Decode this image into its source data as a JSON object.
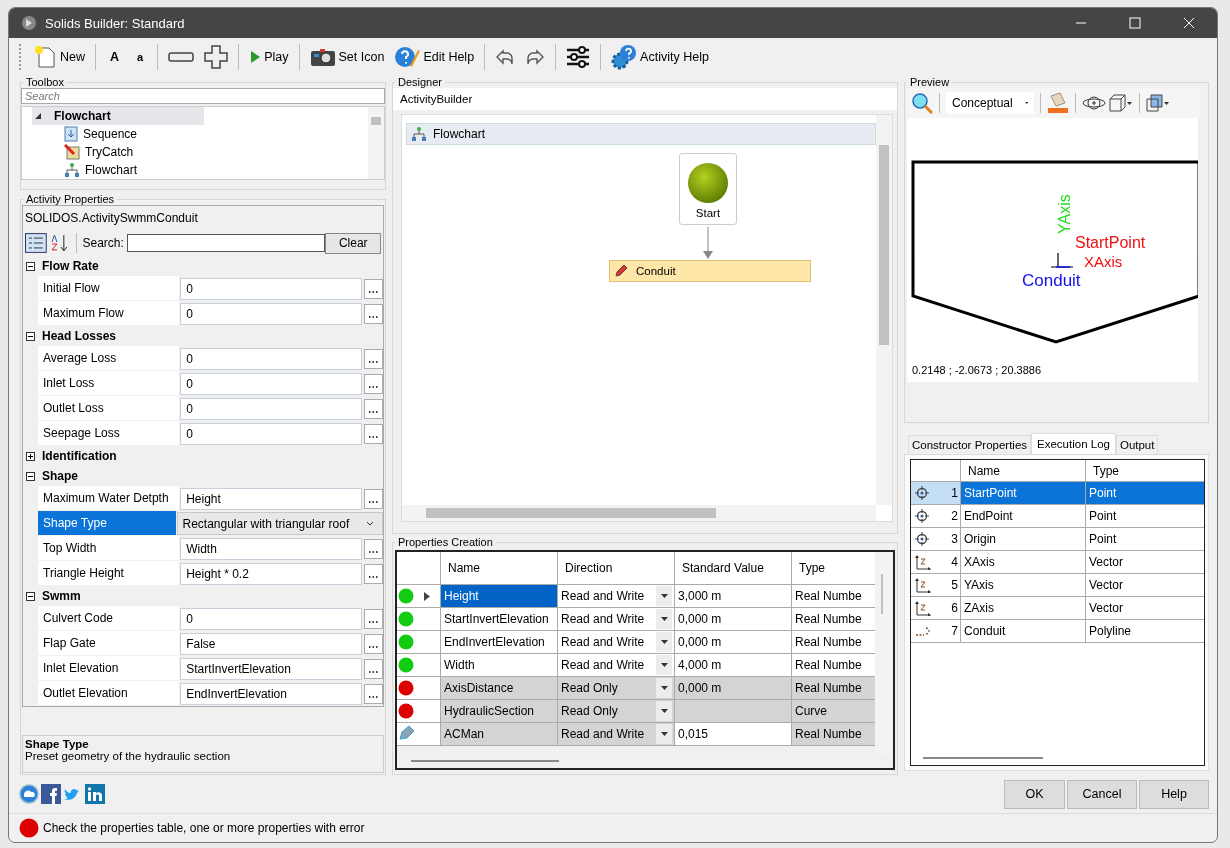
{
  "window": {
    "title": "Solids Builder: Standard"
  },
  "toolbar": [
    [
      {
        "kind": "new",
        "label": "New"
      }
    ],
    [
      {
        "kind": "font-large",
        "label": "A"
      },
      {
        "kind": "font-small",
        "label": "a"
      }
    ],
    [
      {
        "kind": "minus"
      },
      {
        "kind": "plus"
      }
    ],
    [
      {
        "kind": "play",
        "label": "Play"
      }
    ],
    [
      {
        "kind": "camera",
        "label": "Set Icon"
      },
      {
        "kind": "edit-help",
        "label": "Edit Help"
      }
    ],
    [
      {
        "kind": "undo"
      },
      {
        "kind": "redo"
      }
    ],
    [
      {
        "kind": "sliders"
      }
    ],
    [
      {
        "kind": "gear-help",
        "label": "Activity Help"
      }
    ]
  ],
  "toolbox": {
    "title": "Toolbox",
    "placeholder": "Search",
    "tree": [
      {
        "label": "Flowchart",
        "expanded": true,
        "selected": true,
        "children": [
          {
            "label": "Sequence",
            "kind": "sequence"
          },
          {
            "label": "TryCatch",
            "kind": "trycatch"
          },
          {
            "label": "Flowchart",
            "kind": "flowchart"
          }
        ]
      }
    ]
  },
  "activity_properties": {
    "title": "Activity Properties",
    "object": "SOLIDOS.ActivitySwmmConduit",
    "search_label": "Search:",
    "clear": "Clear",
    "categories": [
      {
        "name": "Flow Rate",
        "expanded": true,
        "properties": [
          {
            "name": "Initial Flow",
            "value": "0",
            "kind": "text",
            "selected": false
          },
          {
            "name": "Maximum Flow",
            "value": "0",
            "kind": "text",
            "selected": false
          }
        ]
      },
      {
        "name": "Head Losses",
        "expanded": true,
        "properties": [
          {
            "name": "Average Loss",
            "value": "0",
            "kind": "text",
            "selected": false
          },
          {
            "name": "Inlet Loss",
            "value": "0",
            "kind": "text",
            "selected": false
          },
          {
            "name": "Outlet Loss",
            "value": "0",
            "kind": "text",
            "selected": false
          },
          {
            "name": "Seepage Loss",
            "value": "0",
            "kind": "text",
            "selected": false
          }
        ]
      },
      {
        "name": "Identification",
        "expanded": false
      },
      {
        "name": "Shape",
        "expanded": true,
        "properties": [
          {
            "name": "Maximum Water Detpth",
            "value": "Height",
            "kind": "text",
            "selected": false
          },
          {
            "name": "Shape Type",
            "value": "Rectangular with triangular roof",
            "kind": "dropdown",
            "selected": true
          },
          {
            "name": "Top Width",
            "value": "Width",
            "kind": "text",
            "selected": false
          },
          {
            "name": "Triangle Height",
            "value": "Height * 0.2",
            "kind": "text",
            "selected": false
          }
        ]
      },
      {
        "name": "Swmm",
        "expanded": true,
        "properties": [
          {
            "name": "Culvert Code",
            "value": "0",
            "kind": "text",
            "selected": false
          },
          {
            "name": "Flap Gate",
            "value": "False",
            "kind": "text",
            "selected": false
          },
          {
            "name": "Inlet Elevation",
            "value": "StartInvertElevation",
            "kind": "text",
            "selected": false
          },
          {
            "name": "Outlet Elevation",
            "value": "EndInvertElevation",
            "kind": "text",
            "selected": false
          }
        ]
      }
    ],
    "description": {
      "title": "Shape Type",
      "text": "Preset geometry of the hydraulic section"
    }
  },
  "designer": {
    "title": "Designer",
    "breadcrumb": "ActivityBuilder",
    "flowchart": "Flowchart",
    "start": "Start",
    "activity": "Conduit"
  },
  "properties_creation": {
    "title": "Properties Creation",
    "columns": [
      "Name",
      "Direction",
      "Standard Value",
      "Type"
    ],
    "rows": [
      {
        "status": {
          "kind": "dot",
          "color": "#11cc11"
        },
        "current": true,
        "selected": true,
        "locked": false,
        "read_only": false,
        "name": "Height",
        "direction": "Read and Write",
        "value": "3,000 m",
        "type": "Real Numbe"
      },
      {
        "status": {
          "kind": "dot",
          "color": "#11cc11"
        },
        "current": false,
        "selected": false,
        "locked": false,
        "read_only": false,
        "name": "StartInvertElevation",
        "direction": "Read and Write",
        "value": "0,000 m",
        "type": "Real Numbe"
      },
      {
        "status": {
          "kind": "dot",
          "color": "#11cc11"
        },
        "current": false,
        "selected": false,
        "locked": false,
        "read_only": false,
        "name": "EndInvertElevation",
        "direction": "Read and Write",
        "value": "0,000 m",
        "type": "Real Numbe"
      },
      {
        "status": {
          "kind": "dot",
          "color": "#11cc11"
        },
        "current": false,
        "selected": false,
        "locked": false,
        "read_only": false,
        "name": "Width",
        "direction": "Read and Write",
        "value": "4,000 m",
        "type": "Real Numbe"
      },
      {
        "status": {
          "kind": "dot",
          "color": "#dd0000"
        },
        "current": false,
        "selected": false,
        "locked": true,
        "read_only": true,
        "name": "AxisDistance",
        "direction": "Read Only",
        "value": "0,000 m",
        "type": "Real Numbe"
      },
      {
        "status": {
          "kind": "dot",
          "color": "#dd0000"
        },
        "current": false,
        "selected": false,
        "locked": true,
        "read_only": true,
        "name": "HydraulicSection",
        "direction": "Read Only",
        "type": "Curve"
      },
      {
        "status": {
          "kind": "pencil"
        },
        "current": false,
        "selected": false,
        "locked": true,
        "read_only": false,
        "name": "ACMan",
        "direction": "Read and Write",
        "value": "0,015",
        "type": "Real Numbe"
      }
    ]
  },
  "preview": {
    "title": "Preview",
    "render_mode": "Conceptual",
    "labels": [
      {
        "kind": "y-axis",
        "text": "YAxis",
        "color": "#22dd22"
      },
      {
        "kind": "start",
        "text": "StartPoint",
        "color": "#ee1111"
      },
      {
        "kind": "x-axis",
        "text": "XAxis",
        "color": "#ee1111"
      },
      {
        "kind": "name",
        "text": "Conduit",
        "color": "#1111ee"
      }
    ],
    "coordinates": "0.2148 ; -2.0673 ; 20.3886"
  },
  "tabs": [
    {
      "label": "Constructor Properties",
      "selected": false
    },
    {
      "label": "Execution Log",
      "selected": true
    },
    {
      "label": "Output",
      "selected": false
    }
  ],
  "log": {
    "columns": [
      "Name",
      "Type"
    ],
    "rows": [
      {
        "index": "1",
        "name": "StartPoint",
        "type": "Point",
        "kind": "point",
        "selected": true
      },
      {
        "index": "2",
        "name": "EndPoint",
        "type": "Point",
        "kind": "point",
        "selected": false
      },
      {
        "index": "3",
        "name": "Origin",
        "type": "Point",
        "kind": "point",
        "selected": false
      },
      {
        "index": "4",
        "name": "XAxis",
        "type": "Vector",
        "kind": "vector",
        "selected": false
      },
      {
        "index": "5",
        "name": "YAxis",
        "type": "Vector",
        "kind": "vector",
        "selected": false
      },
      {
        "index": "6",
        "name": "ZAxis",
        "type": "Vector",
        "kind": "vector",
        "selected": false
      },
      {
        "index": "7",
        "name": "Conduit",
        "type": "Polyline",
        "kind": "polyline",
        "selected": false
      }
    ]
  },
  "buttons": [
    "OK",
    "Cancel",
    "Help"
  ],
  "status_bar": {
    "color": "#dd0000",
    "message": "Check the properties table, one or more properties with error"
  }
}
